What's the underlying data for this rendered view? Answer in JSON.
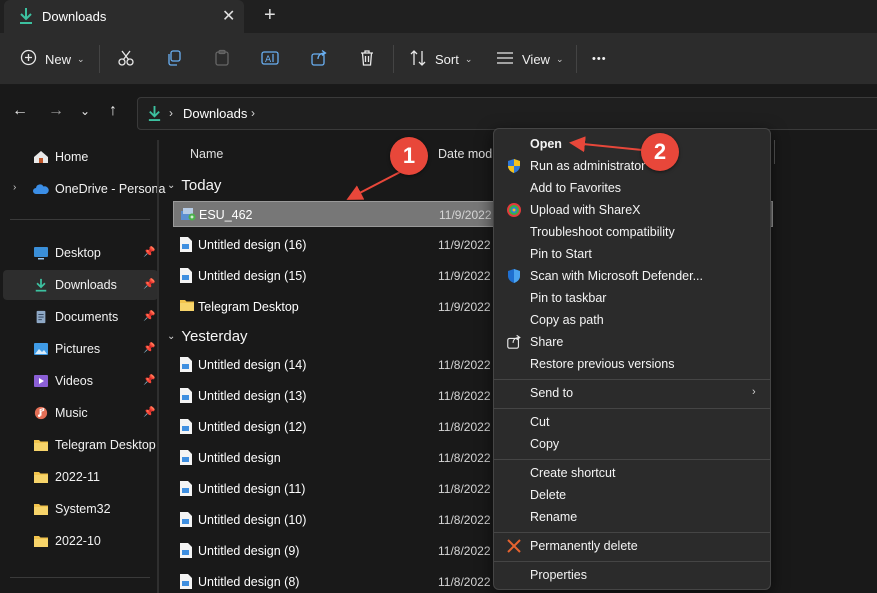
{
  "window": {
    "tab_title": "Downloads",
    "tab_close": "✕",
    "new_tab": "+"
  },
  "toolbar": {
    "new_label": "New",
    "sort_label": "Sort",
    "view_label": "View",
    "more": "•••"
  },
  "address": {
    "crumb": "Downloads"
  },
  "sidebar": {
    "items": [
      {
        "label": "Home",
        "icon": "home-icon"
      },
      {
        "label": "OneDrive - Persona",
        "icon": "onedrive-icon"
      },
      {
        "label": "Desktop",
        "icon": "desktop-icon"
      },
      {
        "label": "Downloads",
        "icon": "download-icon"
      },
      {
        "label": "Documents",
        "icon": "documents-icon"
      },
      {
        "label": "Pictures",
        "icon": "pictures-icon"
      },
      {
        "label": "Videos",
        "icon": "videos-icon"
      },
      {
        "label": "Music",
        "icon": "music-icon"
      },
      {
        "label": "Telegram Desktop",
        "icon": "folder-icon"
      },
      {
        "label": "2022-11",
        "icon": "folder-icon"
      },
      {
        "label": "System32",
        "icon": "folder-icon"
      },
      {
        "label": "2022-10",
        "icon": "folder-icon"
      }
    ]
  },
  "files": {
    "columns": {
      "name": "Name",
      "date": "Date modi"
    },
    "groups": [
      {
        "title": "Today",
        "rows": [
          {
            "name": "ESU_462",
            "date": "11/9/2022",
            "icon": "installer-icon"
          },
          {
            "name": "Untitled design (16)",
            "date": "11/9/2022",
            "icon": "image-file-icon"
          },
          {
            "name": "Untitled design (15)",
            "date": "11/9/2022",
            "icon": "image-file-icon"
          },
          {
            "name": "Telegram Desktop",
            "date": "11/9/2022",
            "icon": "folder-icon"
          }
        ]
      },
      {
        "title": "Yesterday",
        "rows": [
          {
            "name": "Untitled design (14)",
            "date": "11/8/2022",
            "icon": "image-file-icon"
          },
          {
            "name": "Untitled design (13)",
            "date": "11/8/2022",
            "icon": "image-file-icon"
          },
          {
            "name": "Untitled design (12)",
            "date": "11/8/2022",
            "icon": "image-file-icon"
          },
          {
            "name": "Untitled design",
            "date": "11/8/2022",
            "icon": "image-file-icon"
          },
          {
            "name": "Untitled design (11)",
            "date": "11/8/2022",
            "icon": "image-file-icon"
          },
          {
            "name": "Untitled design (10)",
            "date": "11/8/2022",
            "icon": "image-file-icon"
          },
          {
            "name": "Untitled design (9)",
            "date": "11/8/2022",
            "icon": "image-file-icon"
          },
          {
            "name": "Untitled design (8)",
            "date": "11/8/2022",
            "icon": "image-file-icon"
          }
        ]
      }
    ]
  },
  "context_menu": {
    "items": [
      {
        "label": "Open",
        "icon": "",
        "bold": true
      },
      {
        "label": "Run as administrator",
        "icon": "uac-shield-icon"
      },
      {
        "label": "Add to Favorites",
        "icon": ""
      },
      {
        "label": "Upload with ShareX",
        "icon": "sharex-icon"
      },
      {
        "label": "Troubleshoot compatibility",
        "icon": ""
      },
      {
        "label": "Pin to Start",
        "icon": ""
      },
      {
        "label": "Scan with Microsoft Defender...",
        "icon": "defender-shield-icon"
      },
      {
        "label": "Pin to taskbar",
        "icon": ""
      },
      {
        "label": "Copy as path",
        "icon": ""
      },
      {
        "label": "Share",
        "icon": "share-icon"
      },
      {
        "label": "Restore previous versions",
        "icon": ""
      },
      {
        "label": "Send to",
        "icon": "",
        "submenu": true
      },
      {
        "label": "Cut",
        "icon": ""
      },
      {
        "label": "Copy",
        "icon": ""
      },
      {
        "label": "Create shortcut",
        "icon": ""
      },
      {
        "label": "Delete",
        "icon": ""
      },
      {
        "label": "Rename",
        "icon": ""
      },
      {
        "label": "Permanently delete",
        "icon": "x-icon"
      },
      {
        "label": "Properties",
        "icon": ""
      }
    ],
    "submenu_arrow": "›"
  },
  "annotations": {
    "badge1": "1",
    "badge2": "2",
    "color": "#e8473a"
  }
}
